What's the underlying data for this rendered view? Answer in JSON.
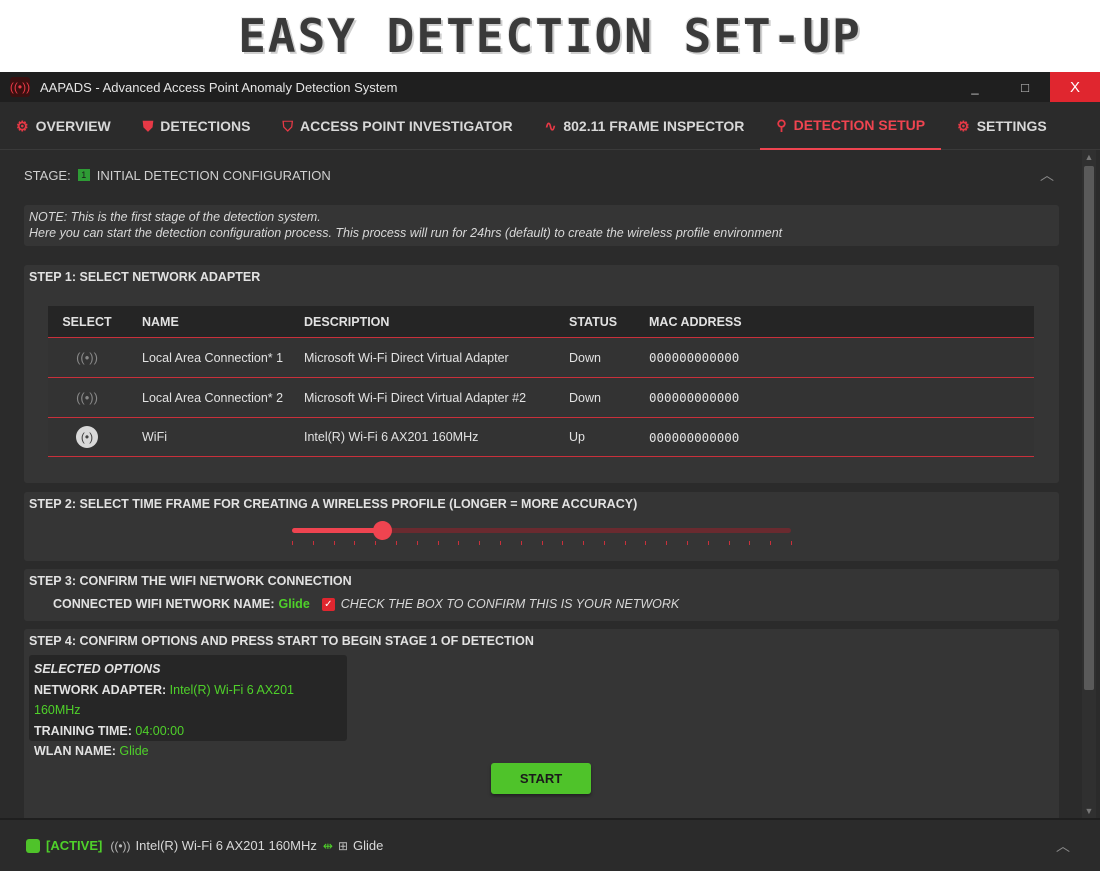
{
  "banner": {
    "text": "EASY DETECTION SET-UP"
  },
  "window": {
    "title": "AAPADS - Advanced Access Point Anomaly Detection System",
    "minimize": "_",
    "maximize": "□",
    "close": "X"
  },
  "tabs": [
    {
      "label": "OVERVIEW",
      "icon": "router-icon",
      "active": false
    },
    {
      "label": "DETECTIONS",
      "icon": "shield-alert-icon",
      "active": false
    },
    {
      "label": "ACCESS POINT INVESTIGATOR",
      "icon": "shield-search-icon",
      "active": false
    },
    {
      "label": "802.11 FRAME INSPECTOR",
      "icon": "wave-icon",
      "active": false
    },
    {
      "label": "DETECTION SETUP",
      "icon": "wrench-icon",
      "active": true
    },
    {
      "label": "SETTINGS",
      "icon": "gear-icon",
      "active": false
    }
  ],
  "stage": {
    "prefix": "STAGE:",
    "number": "1",
    "name": "INITIAL DETECTION CONFIGURATION"
  },
  "note": {
    "line1": "NOTE: This is the first stage of the detection system.",
    "line2": "Here you can start the detection configuration process. This process will run for 24hrs (default) to create the wireless profile environment"
  },
  "step1": {
    "title": "STEP 1: SELECT NETWORK ADAPTER",
    "columns": [
      "SELECT",
      "NAME",
      "DESCRIPTION",
      "STATUS",
      "MAC ADDRESS"
    ],
    "rows": [
      {
        "name": "Local Area Connection* 1",
        "description": "Microsoft Wi-Fi Direct Virtual Adapter",
        "status": "Down",
        "mac": "000000000000",
        "selected": false
      },
      {
        "name": "Local Area Connection* 2",
        "description": "Microsoft Wi-Fi Direct Virtual Adapter #2",
        "status": "Down",
        "mac": "000000000000",
        "selected": false
      },
      {
        "name": "WiFi",
        "description": "Intel(R) Wi-Fi 6 AX201 160MHz",
        "status": "Up",
        "mac": "000000000000",
        "selected": true
      }
    ]
  },
  "step2": {
    "title": "STEP 2: SELECT TIME FRAME FOR CREATING A WIRELESS PROFILE (LONGER = MORE ACCURACY)",
    "slider_fraction": 0.18,
    "tick_count": 25
  },
  "step3": {
    "title": "STEP 3: CONFIRM THE WIFI NETWORK CONNECTION",
    "label": "CONNECTED WIFI NETWORK NAME:",
    "network": "Glide",
    "checked": true,
    "check_mark": "✓",
    "hint": "CHECK THE BOX TO CONFIRM THIS IS YOUR NETWORK"
  },
  "step4": {
    "title": "STEP 4: CONFIRM OPTIONS AND PRESS START TO BEGIN STAGE 1 OF DETECTION",
    "options_header": "SELECTED OPTIONS",
    "adapter_label": "NETWORK ADAPTER:",
    "adapter_value": "Intel(R) Wi-Fi 6 AX201 160MHz",
    "time_label": "TRAINING TIME:",
    "time_value": "04:00:00",
    "wlan_label": "WLAN NAME:",
    "wlan_value": "Glide",
    "start_label": "START"
  },
  "statusbar": {
    "state": "[ACTIVE]",
    "adapter": "Intel(R) Wi-Fi 6 AX201 160MHz",
    "network": "Glide"
  },
  "colors": {
    "accent": "#ef4450",
    "ok": "#4fd12a",
    "bg": "#2b2b2b",
    "panel": "#353535"
  }
}
